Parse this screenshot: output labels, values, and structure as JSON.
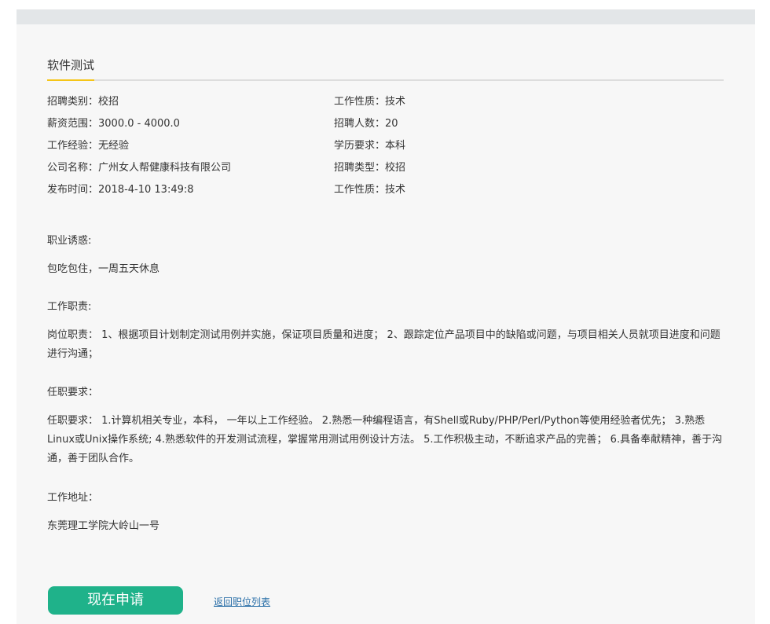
{
  "job": {
    "title": "软件测试"
  },
  "info": {
    "left": [
      "招聘类别：校招",
      "薪资范围：3000.0 - 4000.0",
      "工作经验：无经验",
      "公司名称：广州女人帮健康科技有限公司",
      "发布时间：2018-4-10 13:49:8"
    ],
    "right": [
      "工作性质：技术",
      "招聘人数：20",
      "学历要求：本科",
      "招聘类型：校招",
      "工作性质：技术"
    ]
  },
  "sections": {
    "temptation": {
      "heading": "职业诱惑:",
      "body": "包吃包住，一周五天休息"
    },
    "duties": {
      "heading": "工作职责:",
      "body": "岗位职责： 1、根据项目计划制定测试用例并实施，保证项目质量和进度； 2、跟踪定位产品项目中的缺陷或问题，与项目相关人员就项目进度和问题进行沟通；"
    },
    "requirements": {
      "heading": "任职要求：",
      "body": "任职要求： 1.计算机相关专业，本科， 一年以上工作经验。 2.熟悉一种编程语言，有Shell或Ruby/PHP/Perl/Python等使用经验者优先； 3.熟悉Linux或Unix操作系统; 4.熟悉软件的开发测试流程，掌握常用测试用例设计方法。 5.工作积极主动，不断追求产品的完善； 6.具备奉献精神，善于沟通，善于团队合作。"
    },
    "address": {
      "heading": "工作地址：",
      "body": "东莞理工学院大岭山一号"
    }
  },
  "actions": {
    "apply_label": "现在申请",
    "back_label": "返回职位列表"
  },
  "colors": {
    "accent_bar": "#f5c518",
    "apply_button": "#1fb28a",
    "link": "#2a6fa8"
  }
}
